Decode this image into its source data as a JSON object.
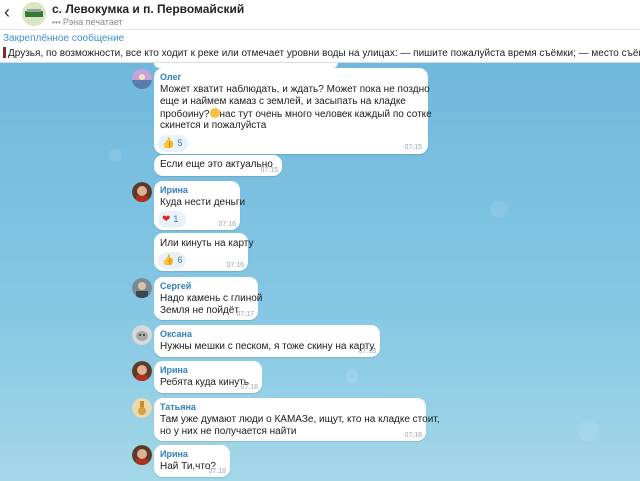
{
  "header": {
    "back_label": "‹",
    "title": "с. Левокумка и п. Первомайский",
    "typing": "Рэна печатает"
  },
  "pinned": {
    "title": "Закреплённое сообщение",
    "text": "Друзья, по возможности, все кто ходит к реке или отмечает уровни воды на улицах: — пишите пожалуйста время съёмки; — место съёмки. Ко всем осталь"
  },
  "messages": [
    {
      "sender": "Олег",
      "lines": [
        "Может хватит наблюдать, и ждать? Может пока не поздно",
        "еще и наймем камаз с землей, и засыпать на кладке",
        "пробоину?",
        "нас тут очень много человек каждый по сотке",
        "скинется и пожалуйста"
      ],
      "reaction_emoji": "👍",
      "reaction_count": "5",
      "time": "07:15"
    },
    {
      "text": "Если еще это актуально",
      "time": "07:15"
    },
    {
      "sender": "Ирина",
      "text": "Куда нести деньги",
      "reaction_emoji": "❤",
      "reaction_count": "1",
      "time": "07:16"
    },
    {
      "text": "Или кинуть на карту",
      "reaction_emoji": "👍",
      "reaction_count": "6",
      "time": "07:16"
    },
    {
      "sender": "Сергей",
      "lines": [
        "Надо камень с глиной",
        "Земля не пойдёт"
      ],
      "time": "07:17"
    },
    {
      "sender": "Оксана",
      "text": "Нужны мешки с песком, я тоже скину на карту.",
      "time": "07:18"
    },
    {
      "sender": "Ирина",
      "text": "Ребята куда кинуть",
      "time": "07:18"
    },
    {
      "sender": "Татьяна",
      "lines": [
        "Там уже думают люди о КАМАЗе, ищут, кто на кладке стоит,",
        "но у них не получается найти"
      ],
      "time": "07:18"
    },
    {
      "sender": "Ирина",
      "text": "Най Ти,что?",
      "time": "07:18"
    }
  ]
}
